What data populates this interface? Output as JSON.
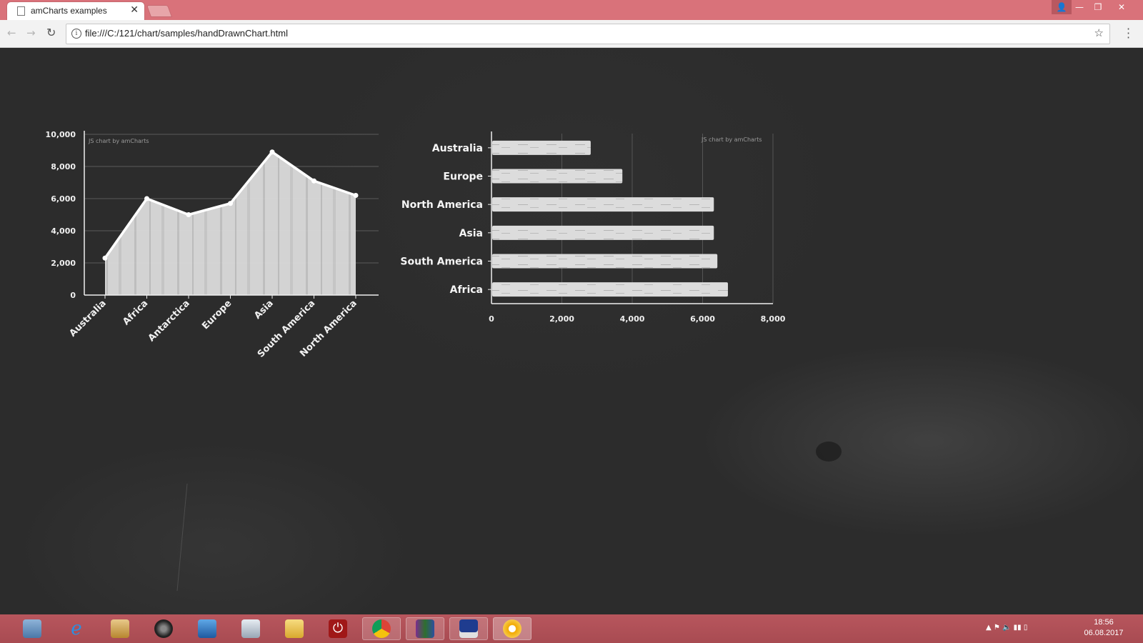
{
  "browser": {
    "tab_title": "amCharts examples",
    "tab_close": "✕",
    "url": "file:///C:/121/chart/samples/handDrawnChart.html",
    "window_controls": {
      "user": "👤",
      "minimize": "—",
      "maximize": "❐",
      "close": "✕"
    }
  },
  "chart_data": [
    {
      "type": "area",
      "categories": [
        "Australia",
        "Africa",
        "Antarctica",
        "Europe",
        "Asia",
        "South America",
        "North America"
      ],
      "values": [
        2300,
        6000,
        5000,
        5700,
        8900,
        7100,
        6200
      ],
      "ylim": [
        0,
        10000
      ],
      "yticks": [
        "0",
        "2,000",
        "4,000",
        "6,000",
        "8,000",
        "10,000"
      ],
      "watermark": "JS chart by amCharts",
      "grid": true
    },
    {
      "type": "bar",
      "orientation": "horizontal",
      "categories": [
        "Australia",
        "Europe",
        "North America",
        "Asia",
        "South America",
        "Africa"
      ],
      "values": [
        2800,
        3700,
        6300,
        6300,
        6400,
        6700
      ],
      "xlim": [
        0,
        8000
      ],
      "xticks": [
        "0",
        "2,000",
        "4,000",
        "6,000",
        "8,000"
      ],
      "watermark": "JS chart by amCharts",
      "grid": true
    }
  ],
  "taskbar": {
    "apps": [
      "docs-icon",
      "internet-explorer-icon",
      "app-icon",
      "speaker-app-icon",
      "settings-app-icon",
      "monitor-app-icon",
      "file-explorer-icon",
      "power-app-icon",
      "chrome-icon",
      "winrar-icon",
      "save-app-icon",
      "chrome-canary-icon"
    ],
    "clock_time": "18:56",
    "clock_date": "06.08.2017"
  },
  "colors": {
    "tabbar": "#d9727a",
    "board": "#2c2c2c",
    "chalk": "#e8e8e8"
  }
}
